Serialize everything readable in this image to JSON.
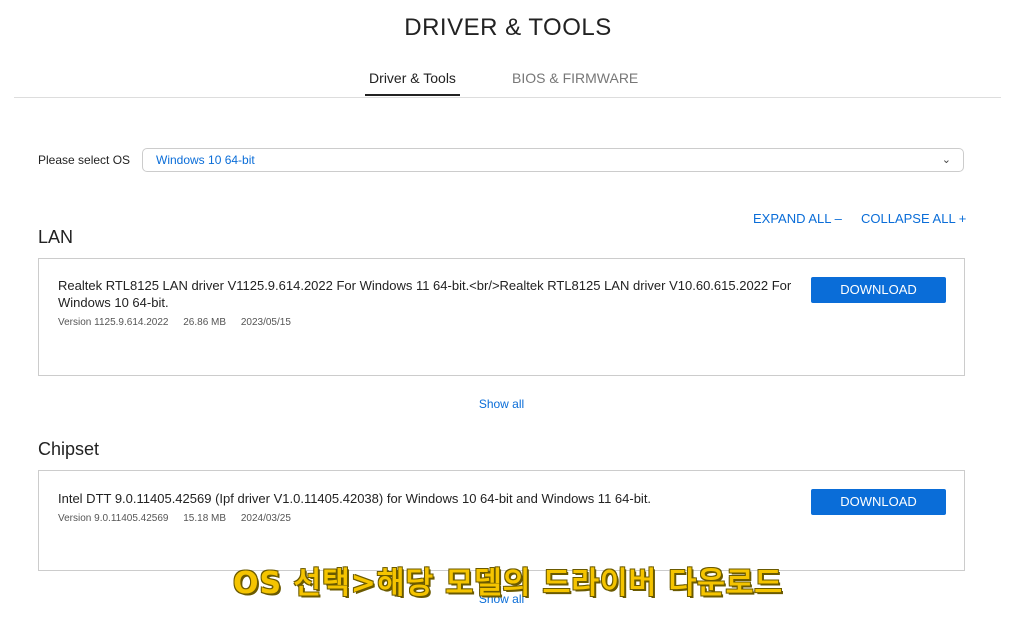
{
  "header": {
    "title": "DRIVER & TOOLS"
  },
  "tabs": [
    {
      "label": "Driver & Tools",
      "active": true
    },
    {
      "label": "BIOS & FIRMWARE",
      "active": false
    }
  ],
  "os_select": {
    "label": "Please select OS",
    "value": "Windows 10 64-bit",
    "icon": "chevron-down-icon"
  },
  "controls": {
    "expand_all": "EXPAND ALL –",
    "collapse_all": "COLLAPSE ALL +"
  },
  "sections": [
    {
      "title": "LAN",
      "items": [
        {
          "description": "Realtek RTL8125 LAN driver V1125.9.614.2022 For Windows 11 64-bit.<br/>Realtek RTL8125 LAN driver V10.60.615.2022 For Windows 10 64-bit.",
          "version": "Version 1125.9.614.2022",
          "size": "26.86 MB",
          "date": "2023/05/15",
          "button": "DOWNLOAD"
        }
      ],
      "show_all": "Show all"
    },
    {
      "title": "Chipset",
      "items": [
        {
          "description": "Intel DTT 9.0.11405.42569 (Ipf driver V1.0.11405.42038) for Windows 10 64-bit and Windows 11 64-bit.",
          "version": "Version 9.0.11405.42569",
          "size": "15.18 MB",
          "date": "2024/03/25",
          "button": "DOWNLOAD"
        }
      ],
      "show_all": "Show all"
    }
  ],
  "overlay_caption": "OS 선택>해당 모델의 드라이버 다운로드",
  "colors": {
    "accent": "#0a6dd8",
    "caption": "#f5c400"
  }
}
